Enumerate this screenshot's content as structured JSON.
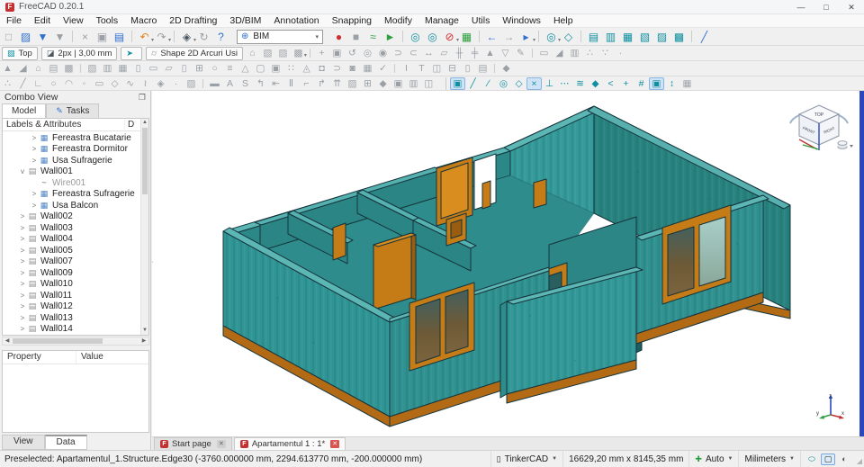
{
  "window": {
    "title": "FreeCAD 0.20.1",
    "logo_letter": "F",
    "controls": {
      "minimize": "—",
      "maximize": "□",
      "close": "✕"
    }
  },
  "menubar": {
    "items": [
      {
        "label": "File"
      },
      {
        "label": "Edit"
      },
      {
        "label": "View"
      },
      {
        "label": "Tools"
      },
      {
        "label": "Macro"
      },
      {
        "label": "2D Drafting"
      },
      {
        "label": "3D/BIM"
      },
      {
        "label": "Annotation"
      },
      {
        "label": "Snapping"
      },
      {
        "label": "Modify"
      },
      {
        "label": "Manage"
      },
      {
        "label": "Utils"
      },
      {
        "label": "Windows"
      },
      {
        "label": "Help"
      }
    ]
  },
  "toolbars": {
    "workbench_selector": {
      "value": "BIM",
      "icon": "workbench-globe-icon"
    },
    "row1_left": [
      {
        "n": "file-new-icon",
        "g": "□",
        "c": "gray"
      },
      {
        "n": "file-open-icon",
        "g": "▨",
        "c": "blue"
      },
      {
        "n": "file-save-icon",
        "g": "▼",
        "c": "blue"
      },
      {
        "n": "file-saveas-icon",
        "g": "▼",
        "c": "gray"
      },
      {
        "n": "edit-cut-icon",
        "g": "×",
        "c": "gray",
        "sep": true
      },
      {
        "n": "edit-copy-icon",
        "g": "▣",
        "c": "gray"
      },
      {
        "n": "edit-paste-icon",
        "g": "▤",
        "c": "blue"
      },
      {
        "n": "undo-icon",
        "g": "↶",
        "c": "orange",
        "dd": true,
        "sep": true
      },
      {
        "n": "redo-icon",
        "g": "↷",
        "c": "gray",
        "dd": true
      },
      {
        "n": "touchpad-nav-icon",
        "g": "◈",
        "c": "dark",
        "dd": true,
        "sep": true
      },
      {
        "n": "refresh-icon",
        "g": "↻",
        "c": "gray"
      },
      {
        "n": "whatsthis-icon",
        "g": "?",
        "c": "blue"
      }
    ],
    "row1_right": [
      {
        "n": "macro-record-icon",
        "g": "●",
        "c": "red"
      },
      {
        "n": "macro-stop-icon",
        "g": "■",
        "c": "gray"
      },
      {
        "n": "macro-edit-icon",
        "g": "≈",
        "c": "green"
      },
      {
        "n": "macro-play-icon",
        "g": "►",
        "c": "green"
      },
      {
        "n": "view-fit-all-icon",
        "g": "◎",
        "c": "teal",
        "sep": true
      },
      {
        "n": "view-fit-selection-icon",
        "g": "◎",
        "c": "teal"
      },
      {
        "n": "view-draw-style-icon",
        "g": "⊘",
        "c": "red",
        "dd": true
      },
      {
        "n": "view-texture-icon",
        "g": "▦",
        "c": "green"
      },
      {
        "n": "nav-back-icon",
        "g": "←",
        "c": "blue",
        "sep": true
      },
      {
        "n": "nav-forward-icon",
        "g": "→",
        "c": "gray"
      },
      {
        "n": "link-navigate-icon",
        "g": "▸",
        "c": "blue",
        "dd": true
      },
      {
        "n": "view-zoom-icon",
        "g": "◎",
        "c": "teal",
        "dd": true,
        "sep": true
      },
      {
        "n": "view-axonometric-icon",
        "g": "◇",
        "c": "teal"
      },
      {
        "n": "view-front-icon",
        "g": "▤",
        "c": "teal",
        "sep": true
      },
      {
        "n": "view-top-icon",
        "g": "▥",
        "c": "teal"
      },
      {
        "n": "view-right-icon",
        "g": "▦",
        "c": "teal"
      },
      {
        "n": "view-rear-icon",
        "g": "▧",
        "c": "teal"
      },
      {
        "n": "view-bottom-icon",
        "g": "▨",
        "c": "teal"
      },
      {
        "n": "view-left-icon",
        "g": "▩",
        "c": "teal"
      },
      {
        "n": "measure-distance-icon",
        "g": "╱",
        "c": "blue",
        "sep": true
      }
    ],
    "row2_buttons": {
      "top_view_label": "Top",
      "top_view_icon": "cube-icon",
      "line_style_label": "2px | 3,00 mm",
      "line_style_icon": "pencil-icon",
      "arrow_tool_icon": "teal-arrow-icon",
      "shape_mode_label": "Shape 2D Arcuri Usi",
      "shape_mode_icon": "outline-icon"
    },
    "row2_icons": [
      {
        "n": "draft-heal-icon",
        "g": "⌂"
      },
      {
        "n": "draft-group-icon",
        "g": "▧"
      },
      {
        "n": "draft-add-to-group-icon",
        "g": "▨"
      },
      {
        "n": "draft-select-group-icon",
        "g": "▩",
        "dd": true
      },
      {
        "n": "modify-move-icon",
        "g": "+",
        "sep": true
      },
      {
        "n": "modify-copy-icon",
        "g": "▣"
      },
      {
        "n": "modify-rotate-icon",
        "g": "↺"
      },
      {
        "n": "modify-offset-icon",
        "g": "◎"
      },
      {
        "n": "modify-2d-offset-icon",
        "g": "◉"
      },
      {
        "n": "modify-trimex-icon",
        "g": "⊃"
      },
      {
        "n": "modify-extend-icon",
        "g": "⊂"
      },
      {
        "n": "modify-stretch-icon",
        "g": "↔"
      },
      {
        "n": "modify-scale-icon",
        "g": "▱"
      },
      {
        "n": "modify-join-icon",
        "g": "╫"
      },
      {
        "n": "modify-split-icon",
        "g": "╪"
      },
      {
        "n": "modify-upgrade-icon",
        "g": "▲"
      },
      {
        "n": "modify-downgrade-icon",
        "g": "▽"
      },
      {
        "n": "draft-edit-icon",
        "g": "✎"
      },
      {
        "n": "modify-wire-to-bspline-icon",
        "g": "▭",
        "sep": true
      },
      {
        "n": "modify-slope-icon",
        "g": "◢"
      },
      {
        "n": "modify-mirror-icon",
        "g": "▥"
      },
      {
        "n": "modify-array-icon",
        "g": "∴"
      },
      {
        "n": "modify-path-array-icon",
        "g": "∵"
      },
      {
        "n": "modify-point-array-icon",
        "g": "·"
      }
    ],
    "row3_icons": [
      {
        "n": "bim-project-icon",
        "g": "▲"
      },
      {
        "n": "bim-site-icon",
        "g": "◢"
      },
      {
        "n": "bim-building-icon",
        "g": "⌂"
      },
      {
        "n": "bim-level-icon",
        "g": "▤"
      },
      {
        "n": "bim-space-icon",
        "g": "▩"
      },
      {
        "n": "bim-group-icon",
        "g": "▧",
        "sep": true
      },
      {
        "n": "bim-wall-icon",
        "g": "▥"
      },
      {
        "n": "bim-curtain-wall-icon",
        "g": "▦"
      },
      {
        "n": "bim-column-icon",
        "g": "▯"
      },
      {
        "n": "bim-beam-icon",
        "g": "▭"
      },
      {
        "n": "bim-slab-icon",
        "g": "▱"
      },
      {
        "n": "bim-door-icon",
        "g": "▯"
      },
      {
        "n": "bim-window-icon",
        "g": "⊞"
      },
      {
        "n": "bim-pipe-icon",
        "g": "○"
      },
      {
        "n": "bim-stairs-icon",
        "g": "≡"
      },
      {
        "n": "bim-roof-icon",
        "g": "△"
      },
      {
        "n": "bim-panel-icon",
        "g": "▢"
      },
      {
        "n": "bim-frame-icon",
        "g": "▣"
      },
      {
        "n": "bim-fence-icon",
        "g": "∷"
      },
      {
        "n": "bim-truss-icon",
        "g": "◬"
      },
      {
        "n": "bim-equipment-icon",
        "g": "◘"
      },
      {
        "n": "bim-rebar-icon",
        "g": "⊃"
      },
      {
        "n": "bim-material-icon",
        "g": "◙"
      },
      {
        "n": "bim-schedule-icon",
        "g": "▦"
      },
      {
        "n": "bim-preflight-icon",
        "g": "✓"
      },
      {
        "n": "bim-ifc-icon",
        "g": "I",
        "sep": true
      },
      {
        "n": "bim-text-icon",
        "g": "T"
      },
      {
        "n": "bim-shape2dview-icon",
        "g": "◫"
      },
      {
        "n": "bim-section-icon",
        "g": "⊟"
      },
      {
        "n": "bim-drawing-icon",
        "g": "▯"
      },
      {
        "n": "bim-techdraw-icon",
        "g": "▤"
      },
      {
        "n": "nativeifc-icon",
        "g": "◆",
        "sep": true
      }
    ],
    "row4_left_icons": [
      {
        "n": "draft-point-icon",
        "g": "∴"
      },
      {
        "n": "draft-line-icon",
        "g": "╱"
      },
      {
        "n": "draft-polyline-icon",
        "g": "∟"
      },
      {
        "n": "draft-circle-icon",
        "g": "○"
      },
      {
        "n": "draft-arc-icon",
        "g": "◠"
      },
      {
        "n": "draft-ellipse-icon",
        "g": "◦"
      },
      {
        "n": "draft-rectangle-icon",
        "g": "▭"
      },
      {
        "n": "draft-polygon-icon",
        "g": "◇"
      },
      {
        "n": "draft-bspline-icon",
        "g": "∿"
      },
      {
        "n": "draft-bezier-icon",
        "g": "≀"
      },
      {
        "n": "draft-facebinder-icon",
        "g": "◈"
      },
      {
        "n": "draft-cubicbezier-icon",
        "g": "·"
      },
      {
        "n": "draft-sketch-icon",
        "g": "▨"
      },
      {
        "n": "annotation-text-icon",
        "g": "▬",
        "sep": true
      },
      {
        "n": "annotation-label-icon",
        "g": "A"
      },
      {
        "n": "annotation-shapestring-icon",
        "g": "S"
      },
      {
        "n": "annotation-leader-icon",
        "g": "↰"
      },
      {
        "n": "annotation-dimension-icon",
        "g": "⇤"
      },
      {
        "n": "annotation-axis-icon",
        "g": "Ⅱ"
      },
      {
        "n": "annotation-axis-system-icon",
        "g": "⌐"
      },
      {
        "n": "annotation-grid-icon",
        "g": "↱"
      },
      {
        "n": "annotation-section-plane-icon",
        "g": "⇈"
      },
      {
        "n": "annotation-hatch-icon",
        "g": "▨"
      },
      {
        "n": "annotation-array-icon",
        "g": "⊞"
      },
      {
        "n": "annotation-clone-icon",
        "g": "◆"
      },
      {
        "n": "annotation-image-icon",
        "g": "▣"
      },
      {
        "n": "annotation-view-icon",
        "g": "▥"
      },
      {
        "n": "annotation-proxy-icon",
        "g": "◫"
      }
    ],
    "row4_snap_icons": [
      {
        "n": "snap-lock-icon",
        "g": "▣",
        "c": "teal",
        "on": true
      },
      {
        "n": "snap-endpoint-icon",
        "g": "╱",
        "c": "teal"
      },
      {
        "n": "snap-midpoint-icon",
        "g": "∕",
        "c": "teal"
      },
      {
        "n": "snap-center-icon",
        "g": "◎",
        "c": "teal"
      },
      {
        "n": "snap-angle-icon",
        "g": "◇",
        "c": "teal"
      },
      {
        "n": "snap-intersection-icon",
        "g": "×",
        "c": "teal",
        "on": true
      },
      {
        "n": "snap-perpendicular-icon",
        "g": "⊥",
        "c": "teal"
      },
      {
        "n": "snap-extension-icon",
        "g": "⋯",
        "c": "teal"
      },
      {
        "n": "snap-parallel-icon",
        "g": "≋",
        "c": "teal"
      },
      {
        "n": "snap-special-icon",
        "g": "◆",
        "c": "teal"
      },
      {
        "n": "snap-near-icon",
        "g": "<",
        "c": "teal"
      },
      {
        "n": "snap-ortho-icon",
        "g": "+",
        "c": "teal"
      },
      {
        "n": "snap-grid-icon",
        "g": "#",
        "c": "teal"
      },
      {
        "n": "snap-working-plane-icon",
        "g": "▣",
        "c": "teal",
        "on": true
      },
      {
        "n": "snap-dimensions-icon",
        "g": "↕",
        "c": "teal"
      },
      {
        "n": "toggle-grid-icon",
        "g": "▦",
        "c": "gray"
      }
    ]
  },
  "combo_view": {
    "title": "Combo View",
    "float_icon": "❐",
    "tabs": {
      "model": "Model",
      "tasks": "Tasks"
    },
    "tree_header": {
      "col1": "Labels & Attributes",
      "col2": "D"
    },
    "tree": [
      {
        "label": "Fereastra Bucatarie",
        "icon": "window",
        "level": 3,
        "exp": ">"
      },
      {
        "label": "Fereastra Dormitor",
        "icon": "window",
        "level": 3,
        "exp": ">"
      },
      {
        "label": "Usa Sufragerie",
        "icon": "window",
        "level": 3,
        "exp": ">"
      },
      {
        "label": "Wall001",
        "icon": "wall",
        "level": 2,
        "exp": "v"
      },
      {
        "label": "Wire001",
        "icon": "wire",
        "level": 3,
        "exp": "",
        "gray": true
      },
      {
        "label": "Fereastra Sufragerie",
        "icon": "window",
        "level": 3,
        "exp": ">"
      },
      {
        "label": "Usa Balcon",
        "icon": "window",
        "level": 3,
        "exp": ">"
      },
      {
        "label": "Wall002",
        "icon": "wall",
        "level": 2,
        "exp": ">"
      },
      {
        "label": "Wall003",
        "icon": "wall",
        "level": 2,
        "exp": ">"
      },
      {
        "label": "Wall004",
        "icon": "wall",
        "level": 2,
        "exp": ">"
      },
      {
        "label": "Wall005",
        "icon": "wall",
        "level": 2,
        "exp": ">"
      },
      {
        "label": "Wall007",
        "icon": "wall",
        "level": 2,
        "exp": ">"
      },
      {
        "label": "Wall009",
        "icon": "wall",
        "level": 2,
        "exp": ">"
      },
      {
        "label": "Wall010",
        "icon": "wall",
        "level": 2,
        "exp": ">"
      },
      {
        "label": "Wall011",
        "icon": "wall",
        "level": 2,
        "exp": ">"
      },
      {
        "label": "Wall012",
        "icon": "wall",
        "level": 2,
        "exp": ">"
      },
      {
        "label": "Wall013",
        "icon": "wall",
        "level": 2,
        "exp": ">"
      },
      {
        "label": "Wall014",
        "icon": "wall",
        "level": 2,
        "exp": ">"
      }
    ],
    "property_panel": {
      "col1": "Property",
      "col2": "Value"
    },
    "bottom_tabs": {
      "view": "View",
      "data": "Data"
    }
  },
  "mdi_tabs": [
    {
      "label": "Start page",
      "close": "gray"
    },
    {
      "label": "Apartamentul 1 : 1*",
      "close": "red",
      "active": true
    }
  ],
  "statusbar": {
    "message": "Preselected: Apartamentul_1.Structure.Edge30 (-3760.000000 mm, 2294.613770 mm, -200.000000 mm)",
    "nav_style": "TinkerCAD",
    "dimensions": "16629,20 mm x 8145,35 mm",
    "snap_mode": "Auto",
    "units": "Milimeters"
  },
  "viewport": {
    "nav_cube": {
      "top": "TOP",
      "front": "FRONT",
      "right": "RIGHT"
    },
    "axis_labels": {
      "x": "x",
      "y": "y",
      "z": "z"
    },
    "colors": {
      "wall_teal": "#2f9594",
      "wall_teal_dark": "#27827f",
      "wall_top": "#5cb6b4",
      "frame_orange": "#c57c17",
      "plinth_orange": "#b26a14",
      "outline": "#15343c",
      "active_edge_blue": "#2b47c0"
    }
  }
}
